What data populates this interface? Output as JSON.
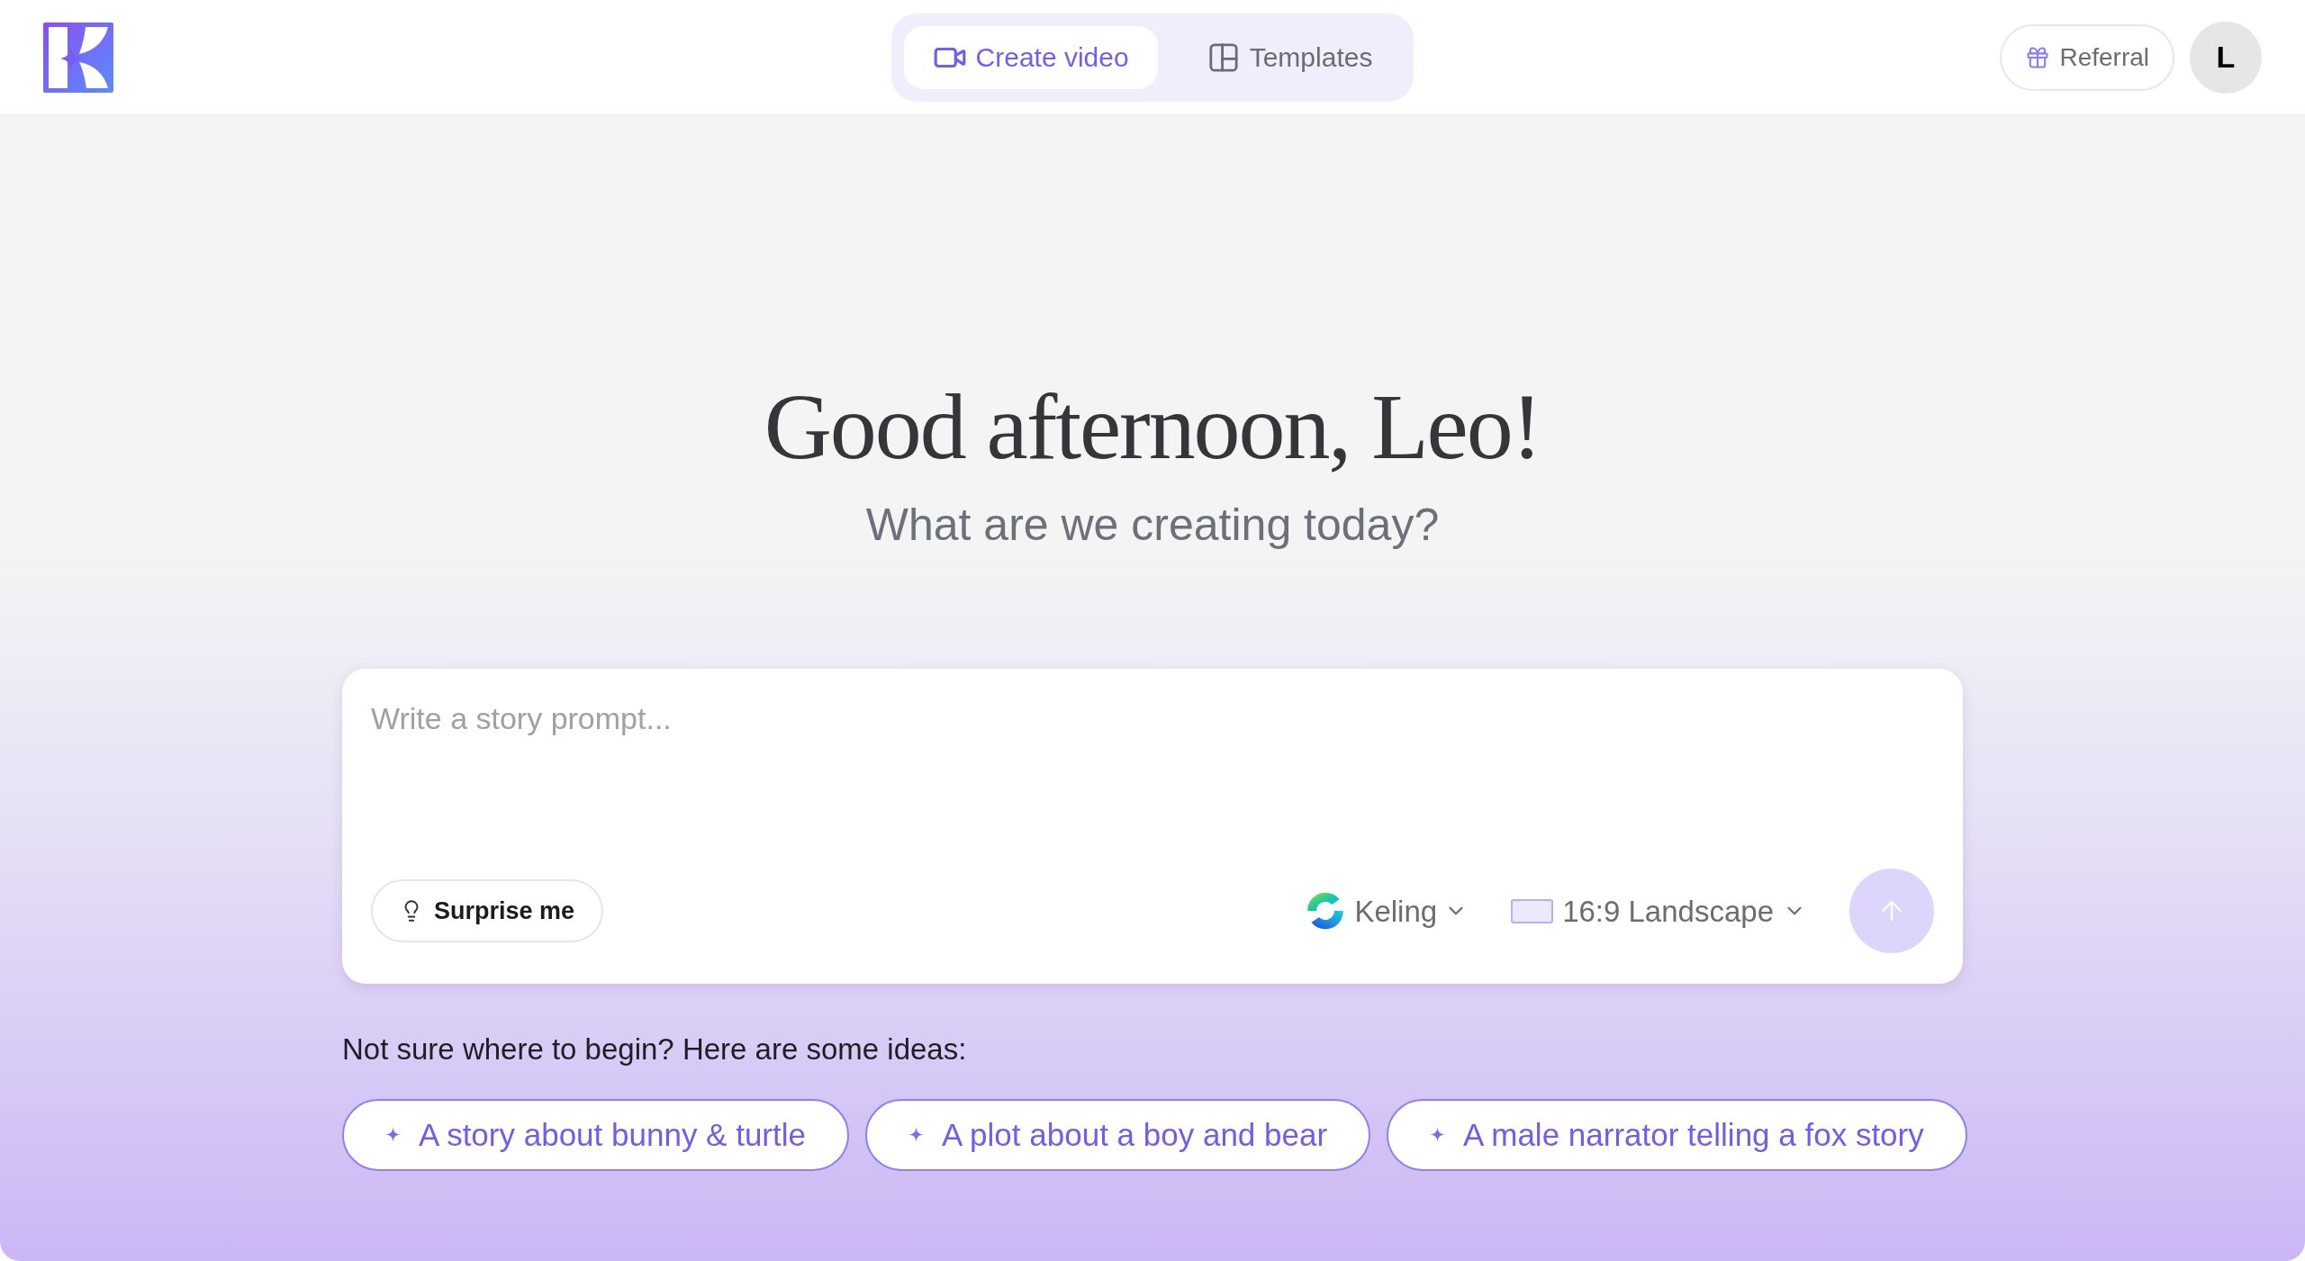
{
  "header": {
    "tabs": [
      {
        "label": "Create video",
        "selected": true
      },
      {
        "label": "Templates",
        "selected": false
      }
    ],
    "referral_button": {
      "label": "Referral"
    },
    "avatar": {
      "initial": "L"
    }
  },
  "greeting": {
    "title": "Good afternoon, Leo!",
    "subtitle": "What are we creating today?"
  },
  "prompt_card": {
    "placeholder": "Write a story prompt...",
    "surprise_button": {
      "label": "Surprise me"
    },
    "model_select": {
      "value": "Keling"
    },
    "aspect_select": {
      "value": "16:9 Landscape"
    },
    "send_button": {
      "disabled": true
    }
  },
  "ideas": {
    "label": "Not sure where to begin? Here are some ideas:",
    "chips": [
      "A story about bunny & turtle",
      "A plot about a boy and bear",
      "A male narrator telling a fox story"
    ]
  }
}
